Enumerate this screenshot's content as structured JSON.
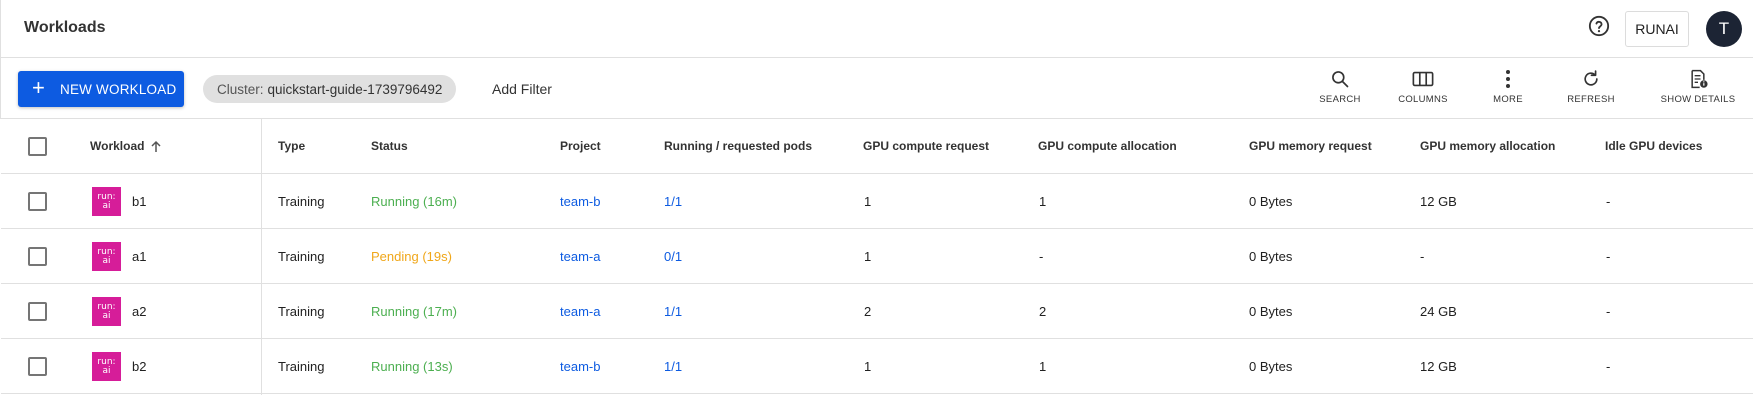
{
  "header": {
    "title": "Workloads",
    "help_icon": "help-circle-icon",
    "account_label": "RUNAI",
    "avatar_initial": "T"
  },
  "toolbar": {
    "new_workload_label": "NEW WORKLOAD",
    "cluster_chip": {
      "label": "Cluster:",
      "value": "quickstart-guide-1739796492"
    },
    "add_filter_label": "Add Filter",
    "actions": {
      "search": "SEARCH",
      "columns": "COLUMNS",
      "more": "MORE",
      "refresh": "REFRESH",
      "show_details": "SHOW DETAILS"
    }
  },
  "table": {
    "columns": {
      "workload": "Workload",
      "type": "Type",
      "status": "Status",
      "project": "Project",
      "pods": "Running / requested pods",
      "gpu_compute_request": "GPU compute request",
      "gpu_compute_allocation": "GPU compute allocation",
      "gpu_memory_request": "GPU memory request",
      "gpu_memory_allocation": "GPU memory allocation",
      "idle_gpu_devices": "Idle GPU devices"
    },
    "sort": {
      "column": "Workload",
      "direction": "ascending"
    },
    "logo_text": {
      "top": "run:",
      "bottom": "ai"
    },
    "rows": [
      {
        "name": "b1",
        "type": "Training",
        "status": "Running (16m)",
        "project": "team-b",
        "pods": "1/1",
        "gpu_compute_request": "1",
        "gpu_compute_allocation": "1",
        "gpu_memory_request": "0 Bytes",
        "gpu_memory_allocation": "12 GB",
        "idle_gpu_devices": "-"
      },
      {
        "name": "a1",
        "type": "Training",
        "status": "Pending (19s)",
        "project": "team-a",
        "pods": "0/1",
        "gpu_compute_request": "1",
        "gpu_compute_allocation": "-",
        "gpu_memory_request": "0 Bytes",
        "gpu_memory_allocation": "-",
        "idle_gpu_devices": "-"
      },
      {
        "name": "a2",
        "type": "Training",
        "status": "Running (17m)",
        "project": "team-a",
        "pods": "1/1",
        "gpu_compute_request": "2",
        "gpu_compute_allocation": "2",
        "gpu_memory_request": "0 Bytes",
        "gpu_memory_allocation": "24 GB",
        "idle_gpu_devices": "-"
      },
      {
        "name": "b2",
        "type": "Training",
        "status": "Running (13s)",
        "project": "team-b",
        "pods": "1/1",
        "gpu_compute_request": "1",
        "gpu_compute_allocation": "1",
        "gpu_memory_request": "0 Bytes",
        "gpu_memory_allocation": "12 GB",
        "idle_gpu_devices": "-"
      }
    ]
  },
  "colors": {
    "primary": "#0d5be1",
    "running": "#4caf50",
    "pending": "#f0a71a",
    "brand_logo": "#d61d99",
    "avatar_bg": "#1c2434"
  }
}
